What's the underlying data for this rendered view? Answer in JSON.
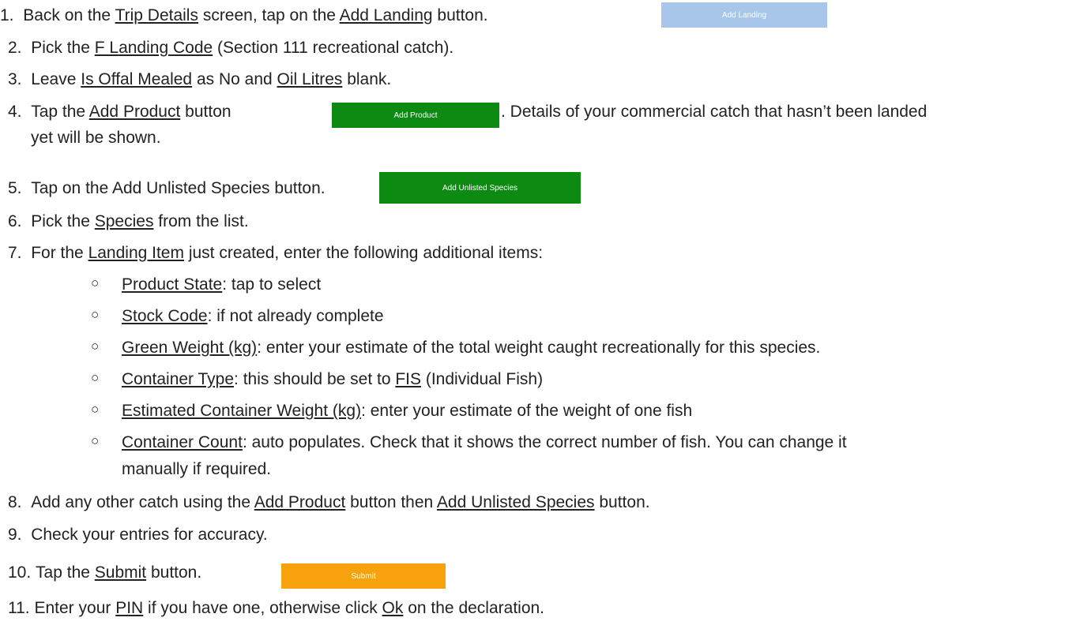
{
  "steps": [
    {
      "num": "1.",
      "pre": "Back on the ",
      "link1": "Trip Details",
      "mid": " screen, tap on the ",
      "link2": "Add Landing",
      "post": " button."
    },
    {
      "num": "2.",
      "pre": "Pick the ",
      "link1": "F Landing Code",
      "post": " (Section 111 recreational catch)."
    },
    {
      "num": "3.",
      "pre": "Leave ",
      "link1": "Is Offal Mealed",
      "mid": " as No and ",
      "link2": "Oil Litres",
      "post": " blank."
    },
    {
      "num": "4.",
      "pre": "Tap the ",
      "link1": "Add Product",
      "mid": " button ",
      "post": ". Details of your commercial catch that hasn’t been landed",
      "cont": "yet will be shown."
    },
    {
      "num": "5.",
      "text": "Tap on the Add Unlisted Species button."
    },
    {
      "num": "6.",
      "pre": "Pick the ",
      "link1": "Species",
      "post": " from the list."
    },
    {
      "num": "7.",
      "pre": "For the ",
      "link1": "Landing Item",
      "post": " just created, enter the following additional items:"
    },
    {
      "num": "8.",
      "pre": "Add any other catch using the ",
      "link1": "Add Product",
      "mid": " button then ",
      "link2": "Add Unlisted Species",
      "post": " button."
    },
    {
      "num": "9.",
      "text": "Check your entries for accuracy."
    },
    {
      "num": "10.",
      "pre": "Tap the ",
      "link1": "Submit",
      "post": " button."
    },
    {
      "num": "11.",
      "pre": "Enter your ",
      "link1": "PIN",
      "mid": " if you have one, otherwise click ",
      "link2": "Ok",
      "post": " on the declaration."
    }
  ],
  "subitems": [
    {
      "bullet": "○",
      "link": "Product State",
      "post": ": tap to select"
    },
    {
      "bullet": "○",
      "link": "Stock Code",
      "post": ": if not already complete"
    },
    {
      "bullet": "○",
      "link": "Green Weight (kg)",
      "post": ": enter your estimate of the total weight caught recreationally for this species."
    },
    {
      "bullet": "○",
      "link": "Container Type",
      "post": ": this should be set to ",
      "link2": "FIS",
      "post2": " (Individual Fish)"
    },
    {
      "bullet": "○",
      "link": "Estimated Container Weight (kg)",
      "post": ": enter your estimate of the weight of one fish"
    },
    {
      "bullet": "○",
      "link": "Container Count",
      "post": ": auto populates. Check that it shows the correct number of fish. You can change it",
      "cont": "manually if required."
    }
  ],
  "buttons": {
    "add_landing": {
      "label": "Add Landing",
      "color": "#a7c6ea"
    },
    "add_product": {
      "label": "Add Product",
      "color": "#0d8a12"
    },
    "add_unlisted": {
      "label": "Add Unlisted Species",
      "color": "#0d8a12"
    },
    "submit": {
      "label": "Submit",
      "color": "#f7a20c"
    }
  }
}
